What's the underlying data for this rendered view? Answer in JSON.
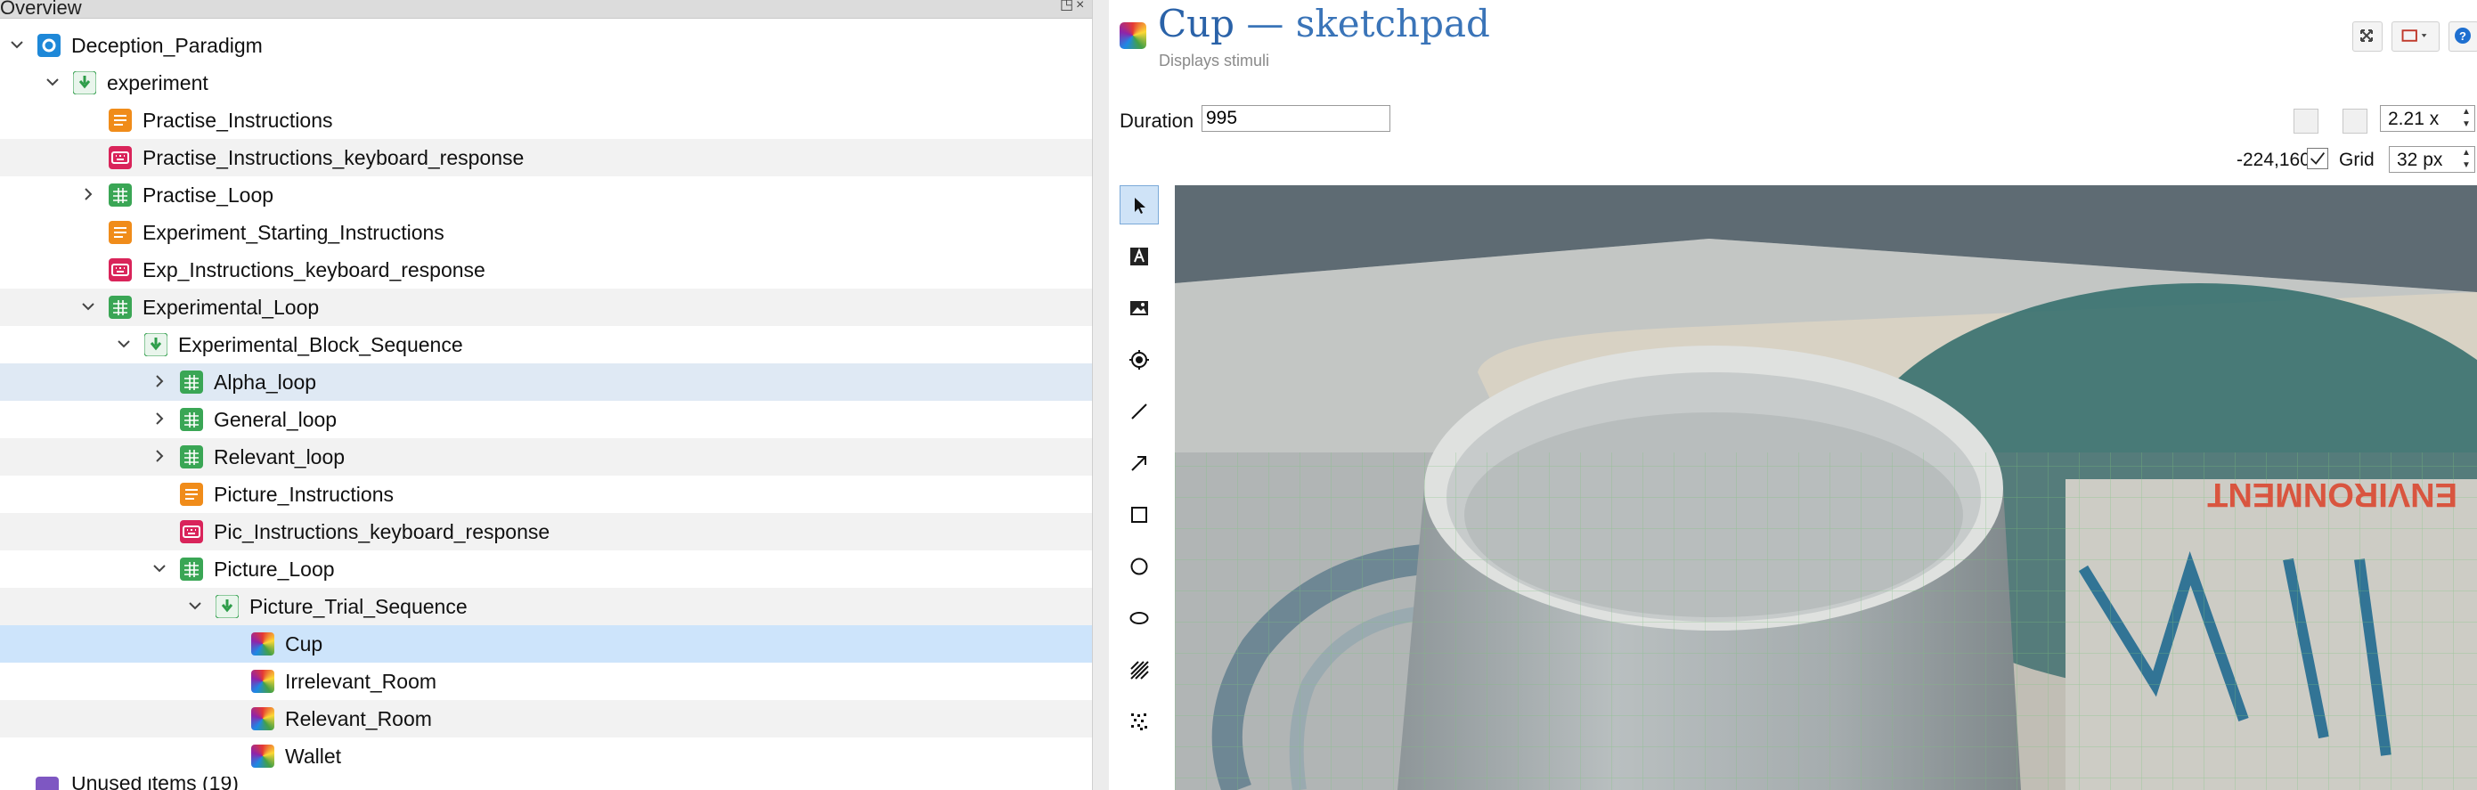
{
  "overview": {
    "title": "Overview",
    "float_glyph": "◳",
    "close_glyph": "×",
    "bottom_item_label": "Unused items (19)",
    "tree": [
      {
        "label": "Deception_Paradigm",
        "level": 0,
        "expanded": true,
        "has_children": true,
        "icon": "experiment-root-icon",
        "alt": false
      },
      {
        "label": "experiment",
        "level": 1,
        "expanded": true,
        "has_children": true,
        "icon": "sequence-icon",
        "alt": false
      },
      {
        "label": "Practise_Instructions",
        "level": 2,
        "has_children": false,
        "icon": "form-text-icon",
        "alt": false
      },
      {
        "label": "Practise_Instructions_keyboard_response",
        "level": 2,
        "has_children": false,
        "icon": "keyboard-icon",
        "alt": true
      },
      {
        "label": "Practise_Loop",
        "level": 2,
        "expanded": false,
        "has_children": true,
        "icon": "loop-icon",
        "alt": false
      },
      {
        "label": "Experiment_Starting_Instructions",
        "level": 2,
        "has_children": false,
        "icon": "form-text-icon",
        "alt": false
      },
      {
        "label": "Exp_Instructions_keyboard_response",
        "level": 2,
        "has_children": false,
        "icon": "keyboard-icon",
        "alt": false
      },
      {
        "label": "Experimental_Loop",
        "level": 2,
        "expanded": true,
        "has_children": true,
        "icon": "loop-icon",
        "alt": true
      },
      {
        "label": "Experimental_Block_Sequence",
        "level": 3,
        "expanded": true,
        "has_children": true,
        "icon": "sequence-icon",
        "alt": false
      },
      {
        "label": "Alpha_loop",
        "level": 4,
        "expanded": false,
        "has_children": true,
        "icon": "loop-icon",
        "highlight": "hl1"
      },
      {
        "label": "General_loop",
        "level": 4,
        "expanded": false,
        "has_children": true,
        "icon": "loop-icon",
        "alt": false
      },
      {
        "label": "Relevant_loop",
        "level": 4,
        "expanded": false,
        "has_children": true,
        "icon": "loop-icon",
        "alt": true
      },
      {
        "label": "Picture_Instructions",
        "level": 4,
        "has_children": false,
        "icon": "form-text-icon",
        "alt": false
      },
      {
        "label": "Pic_Instructions_keyboard_response",
        "level": 4,
        "has_children": false,
        "icon": "keyboard-icon",
        "alt": true
      },
      {
        "label": "Picture_Loop",
        "level": 4,
        "expanded": true,
        "has_children": true,
        "icon": "loop-icon",
        "alt": false
      },
      {
        "label": "Picture_Trial_Sequence",
        "level": 5,
        "expanded": true,
        "has_children": true,
        "icon": "sequence-icon",
        "alt": true
      },
      {
        "label": "Cup",
        "level": 6,
        "has_children": false,
        "icon": "sketchpad-icon",
        "highlight": "hl2"
      },
      {
        "label": "Irrelevant_Room",
        "level": 6,
        "has_children": false,
        "icon": "sketchpad-icon",
        "alt": false
      },
      {
        "label": "Relevant_Room",
        "level": 6,
        "has_children": false,
        "icon": "sketchpad-icon",
        "alt": true
      },
      {
        "label": "Wallet",
        "level": 6,
        "has_children": false,
        "icon": "sketchpad-icon",
        "alt": false
      }
    ]
  },
  "sketchpad": {
    "item_name": "Cup",
    "separator": " — ",
    "item_type": "sketchpad",
    "subtitle": "Displays stimuli",
    "duration_label": "Duration",
    "duration_value": "995",
    "zoom_value": "2.21 x",
    "coords": "-224,160",
    "grid_label": "Grid",
    "grid_enabled": true,
    "grid_value": "32 px",
    "tools": [
      "select-tool",
      "text-tool",
      "image-tool",
      "fixdot-tool",
      "line-tool",
      "arrow-tool",
      "rect-tool",
      "circle-tool",
      "ellipse-tool",
      "gabor-tool",
      "noise-tool"
    ],
    "selected_tool": "select-tool",
    "photo_text": "ENVIRONMENT"
  },
  "colors": {
    "title_blue": "#2a62a8",
    "loop_green": "#3aa655",
    "form_orange": "#f08c1a",
    "keyboard_red": "#d9245a",
    "root_blue": "#1e88d8",
    "sequence_green": "#2e9d4a",
    "selected_row": "#cde4fb"
  }
}
